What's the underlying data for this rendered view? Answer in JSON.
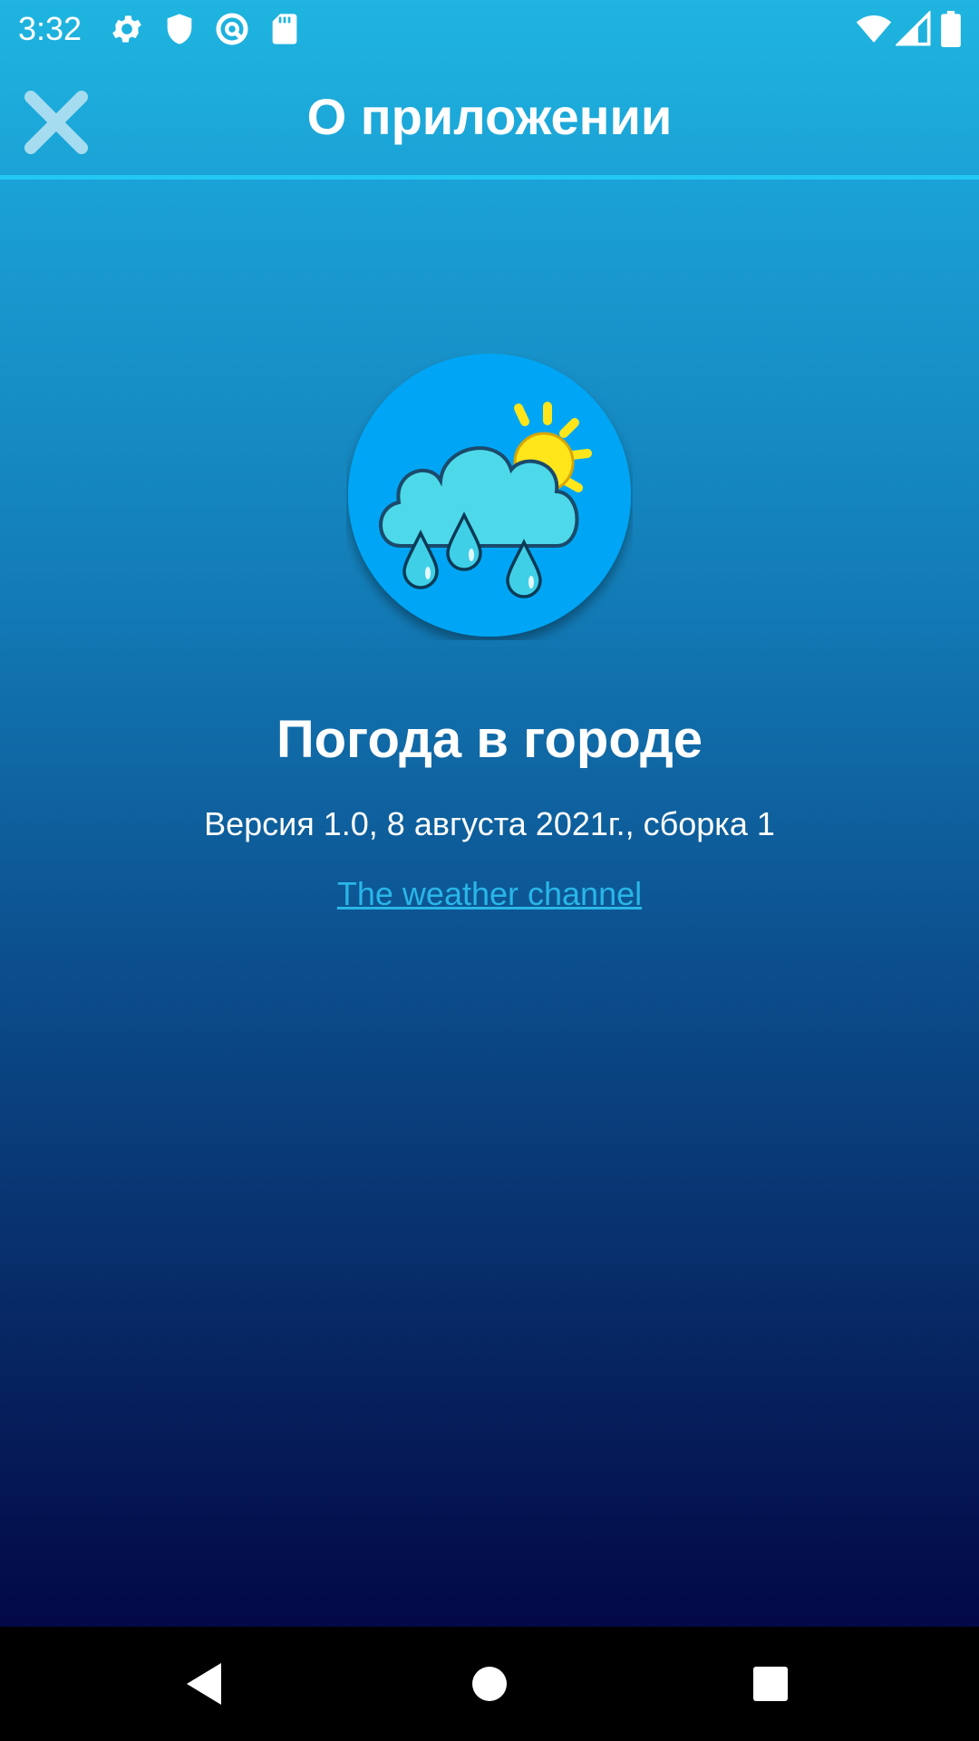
{
  "status_bar": {
    "time": "3:32",
    "icons_left": [
      "settings-gear-icon",
      "shield-icon",
      "vpn-key-icon",
      "sd-card-icon"
    ],
    "icons_right": [
      "wifi-icon",
      "cell-signal-icon",
      "battery-icon"
    ]
  },
  "toolbar": {
    "title": "О приложении",
    "close_icon": "close-icon"
  },
  "about": {
    "app_icon": "weather-rain-cloud-sun-icon",
    "app_name": "Погода в городе",
    "version": "Версия 1.0, 8 августа 2021г., сборка 1",
    "link_text": "The weather channel"
  },
  "nav_bar": {
    "buttons": [
      "back-icon",
      "home-icon",
      "recents-icon"
    ]
  },
  "colors": {
    "accent": "#22c8f4",
    "link": "#29b6e8",
    "icon_circle": "#03a6f5",
    "cloud": "#4dd9ea",
    "sun": "#ffe61a"
  }
}
